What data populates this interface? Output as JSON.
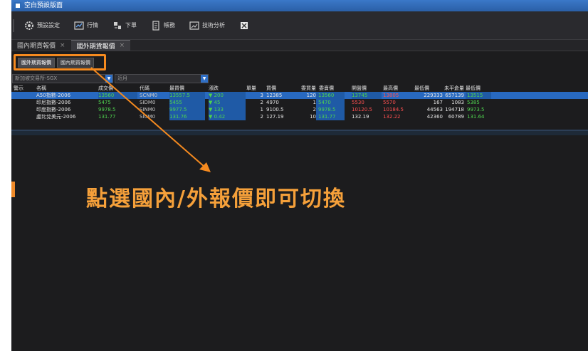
{
  "window": {
    "title": "空白預設版面"
  },
  "toolbar": {
    "items": [
      {
        "label": "預設設定",
        "icon": "gear-icon"
      },
      {
        "label": "行情",
        "icon": "quote-icon"
      },
      {
        "label": "下單",
        "icon": "order-icon"
      },
      {
        "label": "帳務",
        "icon": "account-icon"
      },
      {
        "label": "技術分析",
        "icon": "chart-icon"
      },
      {
        "label": "",
        "icon": "tile-icon"
      }
    ]
  },
  "tabs": [
    {
      "label": "國內期貨報價",
      "active": false
    },
    {
      "label": "國外期貨報價",
      "active": true
    }
  ],
  "subtabs": [
    {
      "label": "國外期貨報價"
    },
    {
      "label": "國內期貨報價"
    }
  ],
  "filters": {
    "exchange": "新加坡交易所-SGX",
    "month": "近月"
  },
  "table": {
    "columns": [
      "警示",
      "名稱",
      "成交價",
      "代碼",
      "最買價",
      "漲跌",
      "單量",
      "買價",
      "委買量",
      "委賣價",
      "開盤價",
      "最高價",
      "最低價",
      "未平倉量",
      "最低價"
    ],
    "rows": [
      {
        "name": "A50指數-2006",
        "last": "13560",
        "code": "SCNM0",
        "bid": "13557.5",
        "chg": "▼ 200",
        "vol": "3",
        "buy": "12385",
        "buyv": "120",
        "sell": "13560",
        "open": "13745",
        "high": "13805",
        "low": "229333",
        "oi": "657139",
        "lowp": "13515",
        "selected": true
      },
      {
        "name": "印尼指數-2006",
        "last": "5475",
        "code": "SIDM0",
        "bid": "5455",
        "chg": "▼ 45",
        "vol": "2",
        "buy": "4970",
        "buyv": "1",
        "sell": "5470",
        "open": "5530",
        "high": "5570",
        "low": "167",
        "oi": "1083",
        "lowp": "5385",
        "selected": false
      },
      {
        "name": "印度指數-2006",
        "last": "9978.5",
        "code": "SINM0",
        "bid": "9977.5",
        "chg": "▼ 133",
        "vol": "1",
        "buy": "9100.5",
        "buyv": "2",
        "sell": "9978.5",
        "open": "10120.5",
        "high": "10184.5",
        "low": "44563",
        "oi": "194718",
        "lowp": "9973.5",
        "selected": false
      },
      {
        "name": "盧比兌美元-2006",
        "last": "131.77",
        "code": "SIUM0",
        "bid": "131.76",
        "chg": "▼ 0.42",
        "vol": "2",
        "buy": "127.19",
        "buyv": "10",
        "sell": "131.77",
        "open": "132.19",
        "high": "132.22",
        "low": "42360",
        "oi": "60789",
        "lowp": "131.64",
        "selected": false
      }
    ]
  },
  "annotation": {
    "text": "點選國內/外報價即可切換",
    "color": "#f5a03a"
  }
}
